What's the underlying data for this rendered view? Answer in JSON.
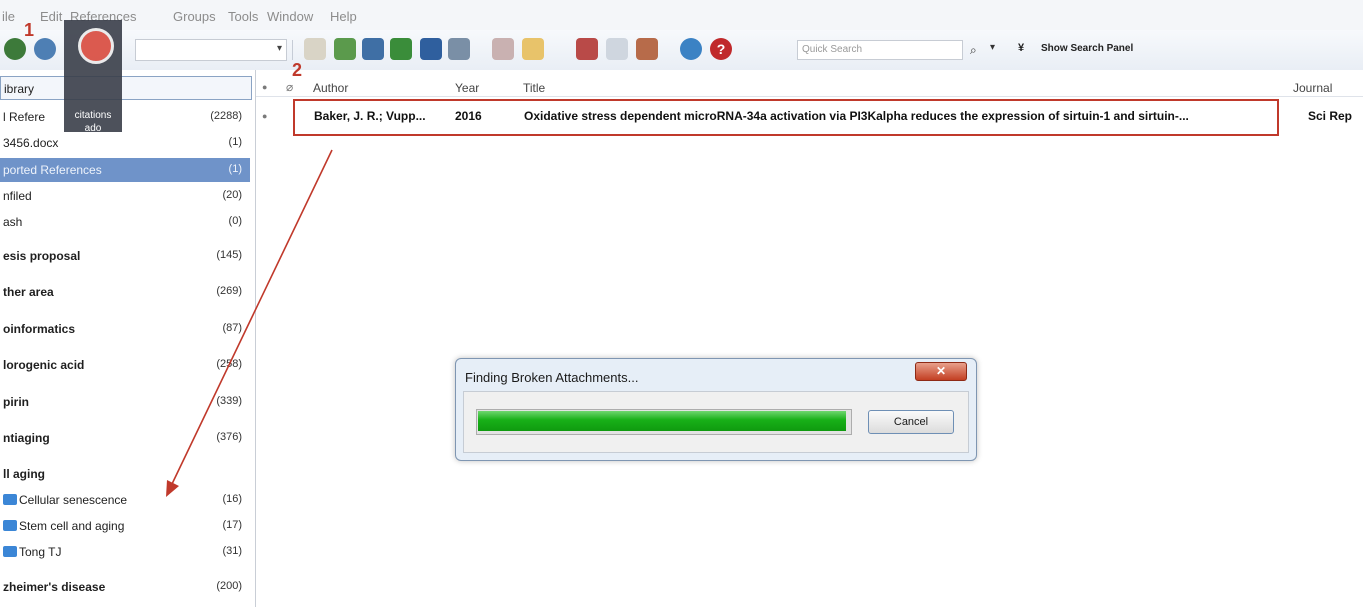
{
  "menu": {
    "file": "ile",
    "edit": "Edit",
    "references": "References",
    "groups": "Groups",
    "tools": "Tools",
    "window": "Window",
    "help": "Help"
  },
  "toolbar": {
    "quick_search_placeholder": "Quick Search",
    "search_dropdown": "▾",
    "show_search_panel": "Show Search Panel"
  },
  "overlay": {
    "marker1": "1",
    "marker2": "2",
    "icon_line1": "citations",
    "icon_line2": "ado"
  },
  "groups": [
    {
      "label": "ibrary",
      "count": ""
    },
    {
      "label": "l Refere",
      "count": "(2288)"
    },
    {
      "label": "3456.docx",
      "count": "(1)"
    },
    {
      "label": "ported References",
      "count": "(1)"
    },
    {
      "label": "nfiled",
      "count": "(20)"
    },
    {
      "label": "ash",
      "count": "(0)"
    },
    {
      "label": "esis proposal",
      "count": "(145)"
    },
    {
      "label": "ther area",
      "count": "(269)"
    },
    {
      "label": "oinformatics",
      "count": "(87)"
    },
    {
      "label": "lorogenic acid",
      "count": "(258)"
    },
    {
      "label": "pirin",
      "count": "(339)"
    },
    {
      "label": "ntiaging",
      "count": "(376)"
    },
    {
      "label": "ll aging",
      "count": ""
    },
    {
      "label": "Cellular senescence",
      "count": "(16)"
    },
    {
      "label": "Stem cell and aging",
      "count": "(17)"
    },
    {
      "label": "Tong TJ",
      "count": "(31)"
    },
    {
      "label": "zheimer's disease",
      "count": "(200)"
    }
  ],
  "columns": {
    "author": "Author",
    "year": "Year",
    "title": "Title",
    "journal": "Journal"
  },
  "reference": {
    "author": "Baker, J. R.; Vupp...",
    "year": "2016",
    "title": "Oxidative stress dependent microRNA-34a activation via PI3Kalpha reduces the expression of sirtuin-1 and sirtuin-...",
    "journal": "Sci Rep"
  },
  "dialog": {
    "title": "Finding Broken Attachments...",
    "close": "✕",
    "cancel": "Cancel",
    "progress": 0.99
  },
  "colors": {
    "accent_red": "#c0392b",
    "selection_blue": "#6f93c9",
    "progress_green": "#18b018"
  }
}
